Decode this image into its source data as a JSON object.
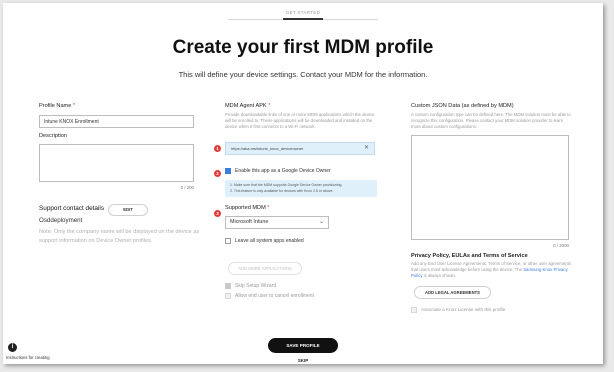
{
  "header": {
    "step": "GET STARTED",
    "title": "Create your first MDM profile",
    "subtitle": "This will define your device settings. Contact your MDM for the information."
  },
  "left": {
    "profile_name_label": "Profile Name",
    "profile_name_value": "Intune KNOX Enrollment",
    "description_label": "Description",
    "description_counter": "0 / 200",
    "support_title": "Support contact details",
    "edit_button": "EDIT",
    "company_name": "Osddeployment",
    "support_hint": "Note: Only the company name will be displayed on the device as support information on Device Owner profiles."
  },
  "middle": {
    "apk_label": "MDM Agent APK",
    "apk_hint": "Provide downloadable links of one or more MDM applications which the device will be enrolled to. These applications will be downloaded and installed on the device when it first connects to a Wi-Fi network.",
    "apk_url": "https://aka.ms/intune_knox_deviceowner",
    "badge_1": "1",
    "badge_2": "2",
    "badge_3": "3",
    "device_owner_label": "Enable this app as a Google Device Owner",
    "info_1": "1. Make sure that the MDM supports Google Device Owner provisioning.",
    "info_2": "2. This feature is only available for devices with Knox 2.8 or above.",
    "supported_mdm_label": "Supported MDM",
    "supported_mdm_value": "Microsoft Intune",
    "leave_apps_label": "Leave all system apps enabled",
    "add_apps_button": "ADD MORE APPLICATIONS",
    "skip_wizard_label": "Skip Setup Wizard",
    "allow_cancel_label": "Allow end user to cancel enrollment"
  },
  "right": {
    "json_label": "Custom JSON Data (as defined by MDM)",
    "json_hint": "A custom configuration type can be defined here. The MDM solution must be able to recognize this configuration. Please contact your MDM solution provider to learn more about custom configurations.",
    "json_counter": "0 / 2000",
    "privacy_title": "Privacy Policy, EULAs and Terms of Service",
    "privacy_hint_a": "Add any End User License Agreements, Terms of Service, or other user agreements that users must acknowledge before using the device. The ",
    "privacy_link": "Samsung Knox Privacy Policy",
    "privacy_hint_b": " is always shown.",
    "add_legal_button": "ADD LEGAL AGREEMENTS",
    "knox_license_label": "Associate a Knox License with this profile"
  },
  "footer": {
    "save_button": "SAVE PROFILE",
    "skip_link": "SKIP",
    "info_text": "Instructions for creating"
  }
}
